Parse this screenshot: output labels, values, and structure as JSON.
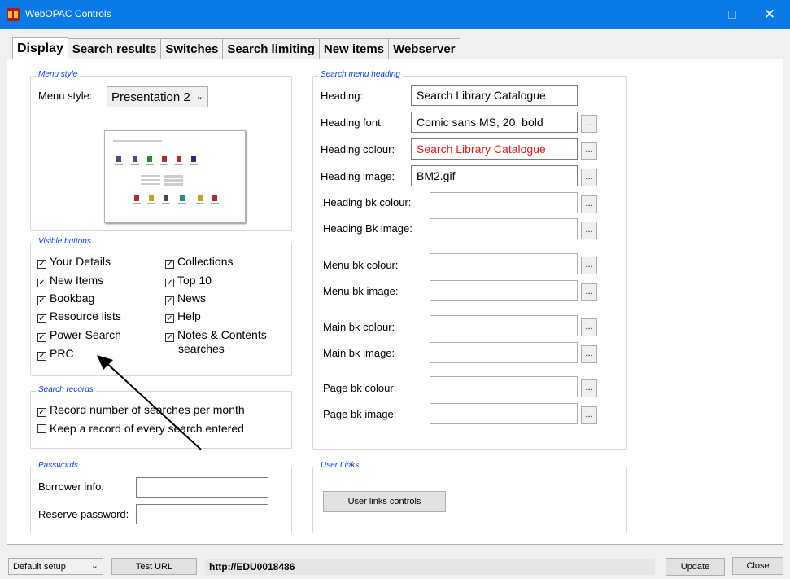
{
  "window": {
    "title": "WebOPAC Controls",
    "minimize_glyph": "—",
    "close_glyph": "✕"
  },
  "tabs": [
    "Display",
    "Search results",
    "Switches",
    "Search limiting",
    "New items",
    "Webserver"
  ],
  "menu_style": {
    "group_title": "Menu style",
    "label": "Menu style:",
    "value": "Presentation 2"
  },
  "visible_buttons": {
    "group_title": "Visible buttons",
    "left": [
      {
        "label": "Your Details",
        "checked": true
      },
      {
        "label": "New Items",
        "checked": true
      },
      {
        "label": "Bookbag",
        "checked": true
      },
      {
        "label": "Resource lists",
        "checked": true
      },
      {
        "label": "Power Search",
        "checked": true
      },
      {
        "label": "PRC",
        "checked": true
      }
    ],
    "right": [
      {
        "label": "Collections",
        "checked": true
      },
      {
        "label": "Top 10",
        "checked": true
      },
      {
        "label": "News",
        "checked": true
      },
      {
        "label": "Help",
        "checked": true
      },
      {
        "label": "Notes & Contents",
        "label2": "searches",
        "checked": true
      }
    ]
  },
  "search_records": {
    "group_title": "Search records",
    "items": [
      {
        "label": "Record number of searches per month",
        "checked": true
      },
      {
        "label": "Keep a record of every search entered",
        "checked": false
      }
    ]
  },
  "passwords": {
    "group_title": "Passwords",
    "borrower_label": "Borrower info:",
    "borrower_value": "",
    "reserve_label": "Reserve password:",
    "reserve_value": ""
  },
  "search_menu_heading": {
    "group_title": "Search menu heading",
    "rows": [
      {
        "label": "Heading:",
        "value": "Search Library Catalogue",
        "dots": false
      },
      {
        "label": "Heading font:",
        "value": "Comic sans MS, 20, bold",
        "dots": true
      },
      {
        "label": "Heading colour:",
        "value": "Search Library Catalogue",
        "dots": true
      },
      {
        "label": "Heading image:",
        "value": "BM2.gif",
        "dots": true
      },
      {
        "label": "Heading bk colour:",
        "value": "",
        "dots": true
      },
      {
        "label": "Heading Bk image:",
        "value": "",
        "dots": true
      },
      {
        "label": "Menu bk colour:",
        "value": "",
        "dots": true
      },
      {
        "label": "Menu bk image:",
        "value": "",
        "dots": true
      },
      {
        "label": "Main bk colour:",
        "value": "",
        "dots": true
      },
      {
        "label": "Main bk image:",
        "value": "",
        "dots": true
      },
      {
        "label": "Page bk colour:",
        "value": "",
        "dots": true
      },
      {
        "label": "Page bk image:",
        "value": "",
        "dots": true
      }
    ],
    "dots_label": "...",
    "heading_colour": "#e31b1b"
  },
  "user_links": {
    "group_title": "User Links",
    "button": "User links controls"
  },
  "footer": {
    "setup_value": "Default setup",
    "test_url": "Test URL",
    "url": "http://EDU0018486",
    "update": "Update",
    "close": "Close"
  },
  "colors": {
    "titlebar": "#0a7ae6",
    "group_title": "#0a3ce6"
  }
}
